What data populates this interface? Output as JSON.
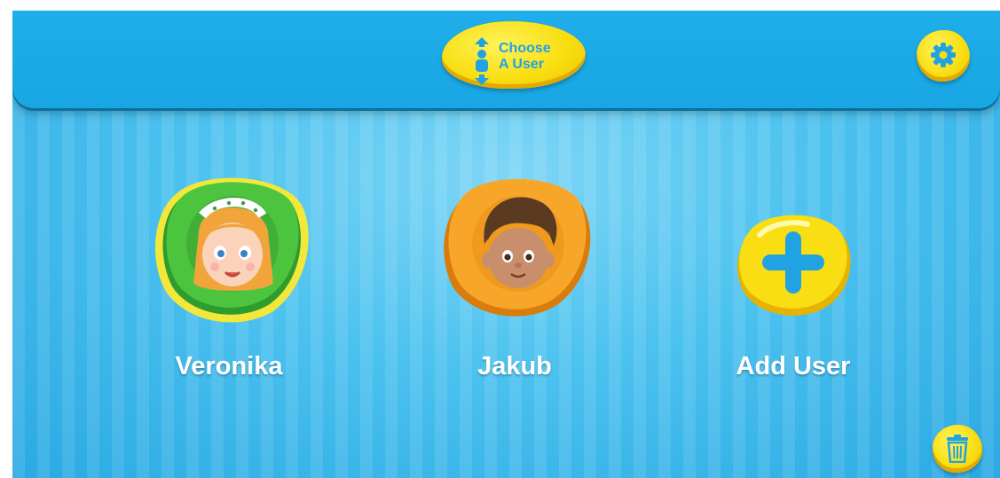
{
  "header": {
    "choose_user_line1": "Choose",
    "choose_user_line2": "A User"
  },
  "users": [
    {
      "name": "Veronika",
      "color": "#3fb639",
      "selected": true
    },
    {
      "name": "Jakub",
      "color": "#f39a1a",
      "selected": false
    }
  ],
  "add_user": {
    "label": "Add User"
  },
  "colors": {
    "background": "#4cc2ef",
    "topbar": "#1aa8e6",
    "button_yellow": "#f8de12",
    "accent_blue": "#21a3e3",
    "selection_glow": "#f3e83a"
  }
}
